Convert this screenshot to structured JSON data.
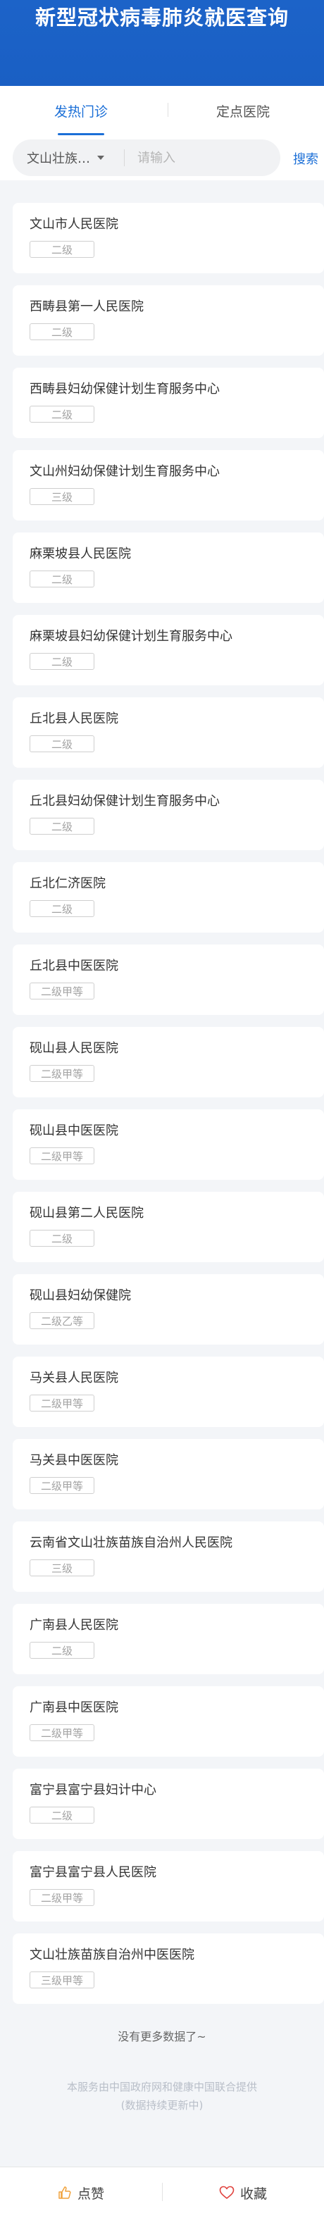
{
  "header": {
    "title": "新型冠状病毒肺炎就医查询"
  },
  "tabs": [
    {
      "label": "发热门诊"
    },
    {
      "label": "定点医院"
    }
  ],
  "search": {
    "region": "文山壮族…",
    "placeholder": "请输入",
    "button": "搜索"
  },
  "hospitals": [
    {
      "name": "文山市人民医院",
      "level": "二级"
    },
    {
      "name": "西畴县第一人民医院",
      "level": "二级"
    },
    {
      "name": "西畴县妇幼保健计划生育服务中心",
      "level": "二级"
    },
    {
      "name": "文山州妇幼保健计划生育服务中心",
      "level": "三级"
    },
    {
      "name": "麻栗坡县人民医院",
      "level": "二级"
    },
    {
      "name": "麻栗坡县妇幼保健计划生育服务中心",
      "level": "二级"
    },
    {
      "name": "丘北县人民医院",
      "level": "二级"
    },
    {
      "name": "丘北县妇幼保健计划生育服务中心",
      "level": "二级"
    },
    {
      "name": "丘北仁济医院",
      "level": "二级"
    },
    {
      "name": "丘北县中医医院",
      "level": "二级甲等"
    },
    {
      "name": "砚山县人民医院",
      "level": "二级甲等"
    },
    {
      "name": "砚山县中医医院",
      "level": "二级甲等"
    },
    {
      "name": "砚山县第二人民医院",
      "level": "二级"
    },
    {
      "name": "砚山县妇幼保健院",
      "level": "二级乙等"
    },
    {
      "name": "马关县人民医院",
      "level": "二级甲等"
    },
    {
      "name": "马关县中医医院",
      "level": "二级甲等"
    },
    {
      "name": "云南省文山壮族苗族自治州人民医院",
      "level": "三级"
    },
    {
      "name": "广南县人民医院",
      "level": "二级"
    },
    {
      "name": "广南县中医医院",
      "level": "二级甲等"
    },
    {
      "name": "富宁县富宁县妇计中心",
      "level": "二级"
    },
    {
      "name": "富宁县富宁县人民医院",
      "level": "二级甲等"
    },
    {
      "name": "文山壮族苗族自治州中医医院",
      "level": "三级甲等"
    }
  ],
  "list_end": "没有更多数据了~",
  "footnote": {
    "line1": "本服务由中国政府网和健康中国联合提供",
    "line2": "(数据持续更新中)"
  },
  "bottom_bar": {
    "like": "点赞",
    "favorite": "收藏"
  },
  "colors": {
    "brand": "#1b6fd7",
    "header_bg": "#1c63c8"
  }
}
